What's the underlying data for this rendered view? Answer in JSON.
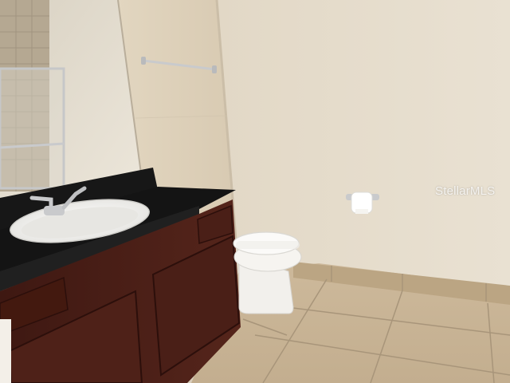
{
  "watermark": {
    "text": "StellarMLS"
  },
  "scene": {
    "colors": {
      "wall": "#e6dccb",
      "wall_shadow": "#d4c8b4",
      "vanity_wood": "#4a1f17",
      "countertop": "#161616",
      "floor_tile": "#c8b496",
      "grout": "#a8957a",
      "porcelain": "#f4f2ee",
      "chrome": "#c9cacc"
    }
  }
}
